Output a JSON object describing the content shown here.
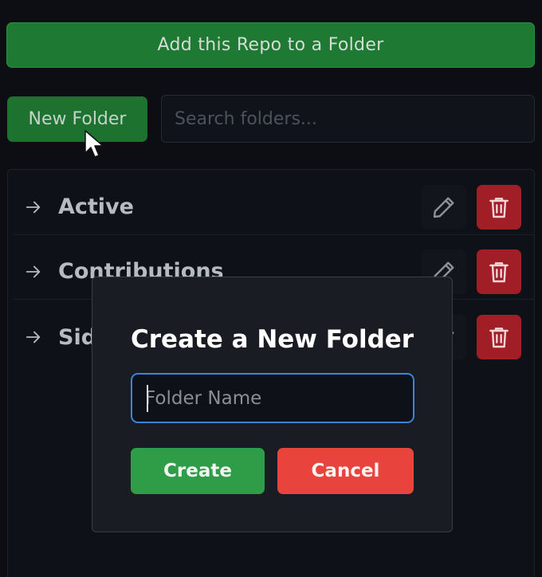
{
  "header": {
    "add_repo_label": "Add this Repo to a Folder"
  },
  "toolbar": {
    "new_folder_label": "New Folder",
    "search_placeholder": "Search folders..."
  },
  "folders": [
    {
      "name": "Active"
    },
    {
      "name": "Contributions"
    },
    {
      "name": "Side"
    }
  ],
  "modal": {
    "title": "Create a New Folder",
    "input_placeholder": "Folder Name",
    "input_value": "",
    "create_label": "Create",
    "cancel_label": "Cancel"
  },
  "colors": {
    "add_button": "#1e7a33",
    "delete_button": "#a21e26",
    "create_button": "#2f9d48",
    "cancel_button": "#e8433d",
    "input_focus": "#3c83df"
  },
  "icons": {
    "row_arrow": "arrow-right-icon",
    "edit": "pencil-icon",
    "delete": "trash-icon",
    "pointer": "mouse-pointer-icon"
  }
}
